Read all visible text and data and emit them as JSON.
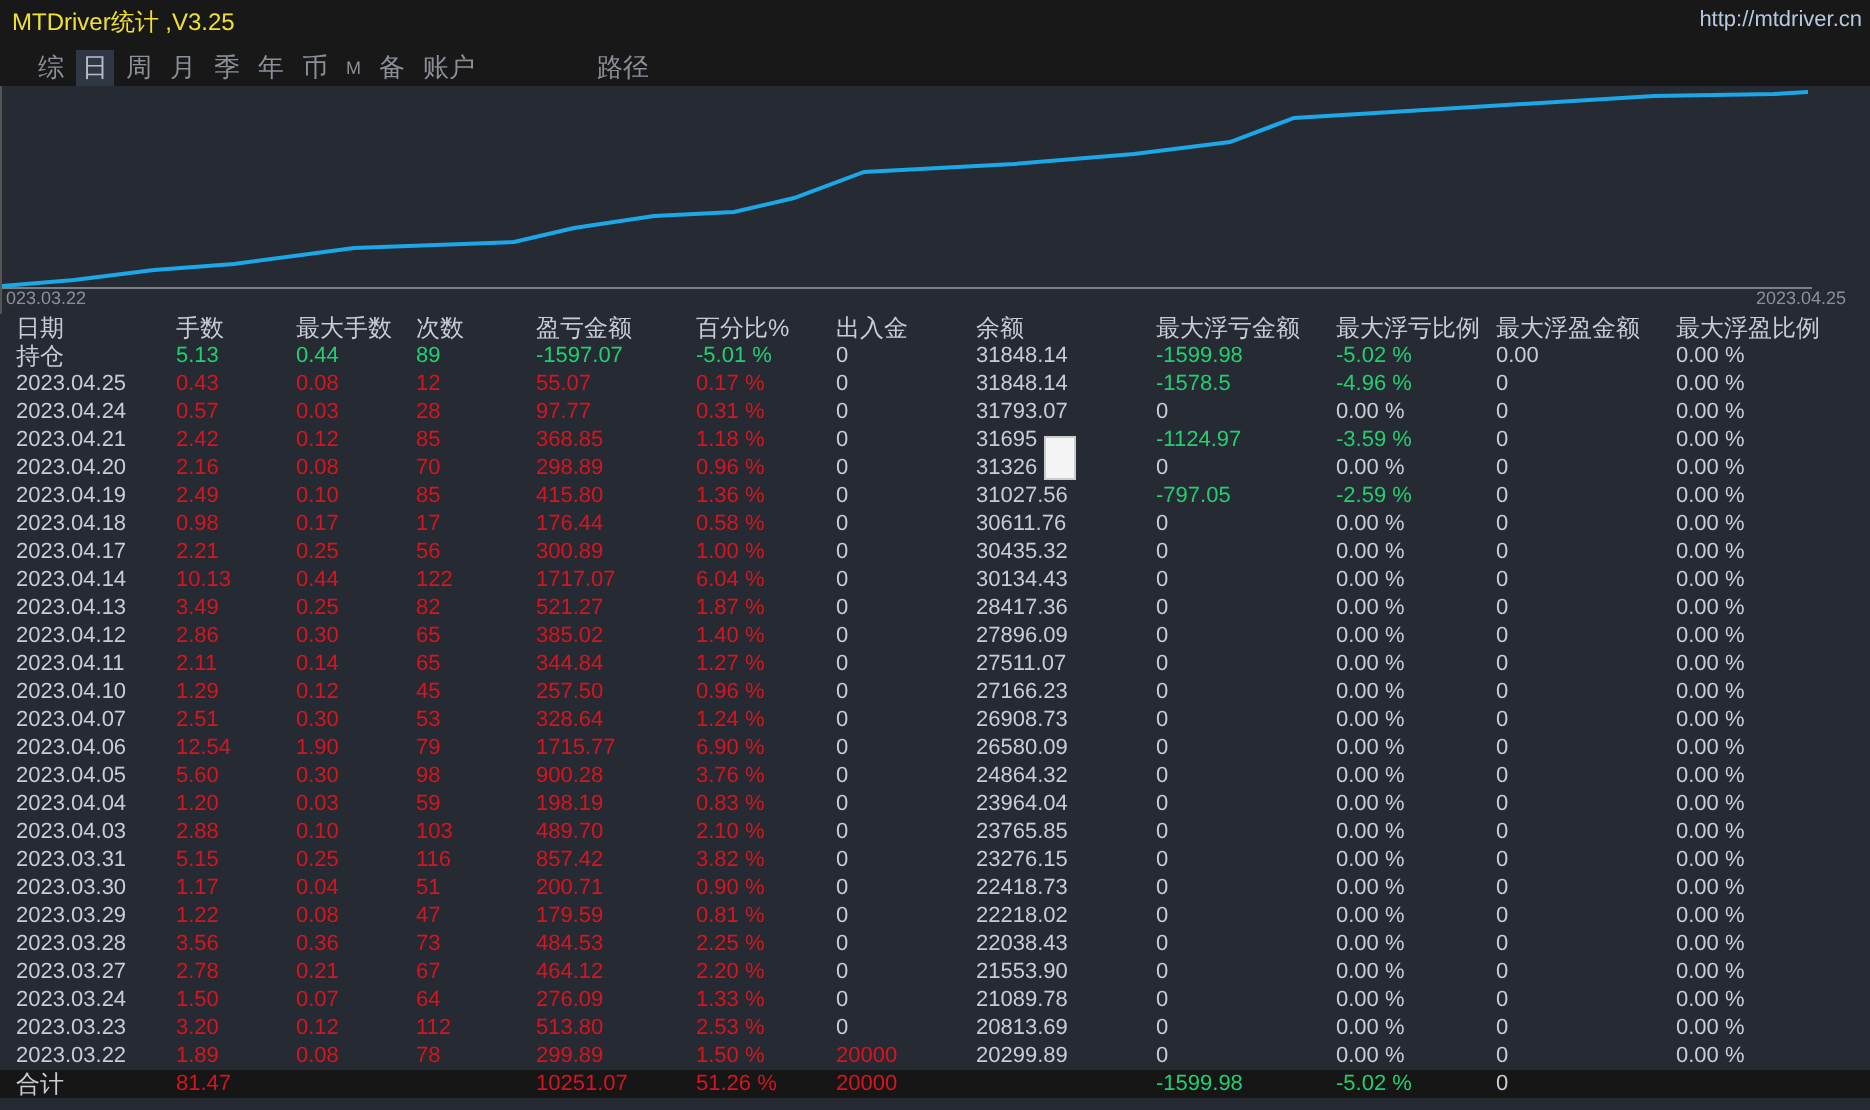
{
  "window": {
    "title": "MTDriver统计 ,V3.25",
    "link": "http://mtdriver.cn"
  },
  "tabs": [
    {
      "label": "综",
      "selected": false
    },
    {
      "label": "日",
      "selected": true
    },
    {
      "label": "周",
      "selected": false
    },
    {
      "label": "月",
      "selected": false
    },
    {
      "label": "季",
      "selected": false
    },
    {
      "label": "年",
      "selected": false
    },
    {
      "label": "币",
      "selected": false
    },
    {
      "label": "M",
      "selected": false
    },
    {
      "label": "备",
      "selected": false
    },
    {
      "label": "账户",
      "selected": false
    }
  ],
  "path_button": "路径",
  "chart": {
    "start_label": "023.03.22",
    "end_label": "2023.04.25"
  },
  "table": {
    "columns": [
      "日期",
      "手数",
      "最大手数",
      "次数",
      "盈亏金额",
      "百分比%",
      "出入金",
      "余额",
      "最大浮亏金额",
      "最大浮亏比例",
      "最大浮盈金额",
      "最大浮盈比例"
    ],
    "rows": [
      {
        "kind": "position",
        "cells": [
          "持仓",
          {
            "text": "5.13",
            "color": "#20d070"
          },
          {
            "text": "0.44",
            "color": "#20d070"
          },
          {
            "text": "89",
            "color": "#20d070"
          },
          {
            "text": "-1597.07",
            "color": "#20d070"
          },
          {
            "text": "-5.01 %",
            "color": "#20d070"
          },
          "0",
          "31848.14",
          {
            "text": "-1599.98",
            "color": "#20d070"
          },
          {
            "text": "-5.02 %",
            "color": "#20d070"
          },
          "0.00",
          "0.00 %"
        ]
      },
      {
        "kind": "day",
        "cells": [
          "2023.04.25",
          {
            "text": "0.43",
            "color": "#d8141e"
          },
          {
            "text": "0.08",
            "color": "#d8141e"
          },
          {
            "text": "12",
            "color": "#d8141e"
          },
          {
            "text": "55.07",
            "color": "#d8141e"
          },
          {
            "text": "0.17 %",
            "color": "#d8141e"
          },
          "0",
          "31848.14",
          {
            "text": "-1578.5",
            "color": "#20d070"
          },
          {
            "text": "-4.96 %",
            "color": "#20d070"
          },
          "0",
          "0.00 %"
        ]
      },
      {
        "kind": "day",
        "cells": [
          "2023.04.24",
          {
            "text": "0.57",
            "color": "#d8141e"
          },
          {
            "text": "0.03",
            "color": "#d8141e"
          },
          {
            "text": "28",
            "color": "#d8141e"
          },
          {
            "text": "97.77",
            "color": "#d8141e"
          },
          {
            "text": "0.31 %",
            "color": "#d8141e"
          },
          "0",
          "31793.07",
          "0",
          "0.00 %",
          "0",
          "0.00 %"
        ]
      },
      {
        "kind": "day",
        "cells": [
          "2023.04.21",
          {
            "text": "2.42",
            "color": "#d8141e"
          },
          {
            "text": "0.12",
            "color": "#d8141e"
          },
          {
            "text": "85",
            "color": "#d8141e"
          },
          {
            "text": "368.85",
            "color": "#d8141e"
          },
          {
            "text": "1.18 %",
            "color": "#d8141e"
          },
          "0",
          "31695",
          {
            "text": "-1124.97",
            "color": "#20d070"
          },
          {
            "text": "-3.59 %",
            "color": "#20d070"
          },
          "0",
          "0.00 %"
        ]
      },
      {
        "kind": "day",
        "cells": [
          "2023.04.20",
          {
            "text": "2.16",
            "color": "#d8141e"
          },
          {
            "text": "0.08",
            "color": "#d8141e"
          },
          {
            "text": "70",
            "color": "#d8141e"
          },
          {
            "text": "298.89",
            "color": "#d8141e"
          },
          {
            "text": "0.96 %",
            "color": "#d8141e"
          },
          "0",
          "31326",
          "0",
          "0.00 %",
          "0",
          "0.00 %"
        ]
      },
      {
        "kind": "day",
        "cells": [
          "2023.04.19",
          {
            "text": "2.49",
            "color": "#d8141e"
          },
          {
            "text": "0.10",
            "color": "#d8141e"
          },
          {
            "text": "85",
            "color": "#d8141e"
          },
          {
            "text": "415.80",
            "color": "#d8141e"
          },
          {
            "text": "1.36 %",
            "color": "#d8141e"
          },
          "0",
          "31027.56",
          {
            "text": "-797.05",
            "color": "#20d070"
          },
          {
            "text": "-2.59 %",
            "color": "#20d070"
          },
          "0",
          "0.00 %"
        ]
      },
      {
        "kind": "day",
        "cells": [
          "2023.04.18",
          {
            "text": "0.98",
            "color": "#d8141e"
          },
          {
            "text": "0.17",
            "color": "#d8141e"
          },
          {
            "text": "17",
            "color": "#d8141e"
          },
          {
            "text": "176.44",
            "color": "#d8141e"
          },
          {
            "text": "0.58 %",
            "color": "#d8141e"
          },
          "0",
          "30611.76",
          "0",
          "0.00 %",
          "0",
          "0.00 %"
        ]
      },
      {
        "kind": "day",
        "cells": [
          "2023.04.17",
          {
            "text": "2.21",
            "color": "#d8141e"
          },
          {
            "text": "0.25",
            "color": "#d8141e"
          },
          {
            "text": "56",
            "color": "#d8141e"
          },
          {
            "text": "300.89",
            "color": "#d8141e"
          },
          {
            "text": "1.00 %",
            "color": "#d8141e"
          },
          "0",
          "30435.32",
          "0",
          "0.00 %",
          "0",
          "0.00 %"
        ]
      },
      {
        "kind": "day",
        "cells": [
          "2023.04.14",
          {
            "text": "10.13",
            "color": "#d8141e"
          },
          {
            "text": "0.44",
            "color": "#d8141e"
          },
          {
            "text": "122",
            "color": "#d8141e"
          },
          {
            "text": "1717.07",
            "color": "#d8141e"
          },
          {
            "text": "6.04 %",
            "color": "#d8141e"
          },
          "0",
          "30134.43",
          "0",
          "0.00 %",
          "0",
          "0.00 %"
        ]
      },
      {
        "kind": "day",
        "cells": [
          "2023.04.13",
          {
            "text": "3.49",
            "color": "#d8141e"
          },
          {
            "text": "0.25",
            "color": "#d8141e"
          },
          {
            "text": "82",
            "color": "#d8141e"
          },
          {
            "text": "521.27",
            "color": "#d8141e"
          },
          {
            "text": "1.87 %",
            "color": "#d8141e"
          },
          "0",
          "28417.36",
          "0",
          "0.00 %",
          "0",
          "0.00 %"
        ]
      },
      {
        "kind": "day",
        "cells": [
          "2023.04.12",
          {
            "text": "2.86",
            "color": "#d8141e"
          },
          {
            "text": "0.30",
            "color": "#d8141e"
          },
          {
            "text": "65",
            "color": "#d8141e"
          },
          {
            "text": "385.02",
            "color": "#d8141e"
          },
          {
            "text": "1.40 %",
            "color": "#d8141e"
          },
          "0",
          "27896.09",
          "0",
          "0.00 %",
          "0",
          "0.00 %"
        ]
      },
      {
        "kind": "day",
        "cells": [
          "2023.04.11",
          {
            "text": "2.11",
            "color": "#d8141e"
          },
          {
            "text": "0.14",
            "color": "#d8141e"
          },
          {
            "text": "65",
            "color": "#d8141e"
          },
          {
            "text": "344.84",
            "color": "#d8141e"
          },
          {
            "text": "1.27 %",
            "color": "#d8141e"
          },
          "0",
          "27511.07",
          "0",
          "0.00 %",
          "0",
          "0.00 %"
        ]
      },
      {
        "kind": "day",
        "cells": [
          "2023.04.10",
          {
            "text": "1.29",
            "color": "#d8141e"
          },
          {
            "text": "0.12",
            "color": "#d8141e"
          },
          {
            "text": "45",
            "color": "#d8141e"
          },
          {
            "text": "257.50",
            "color": "#d8141e"
          },
          {
            "text": "0.96 %",
            "color": "#d8141e"
          },
          "0",
          "27166.23",
          "0",
          "0.00 %",
          "0",
          "0.00 %"
        ]
      },
      {
        "kind": "day",
        "cells": [
          "2023.04.07",
          {
            "text": "2.51",
            "color": "#d8141e"
          },
          {
            "text": "0.30",
            "color": "#d8141e"
          },
          {
            "text": "53",
            "color": "#d8141e"
          },
          {
            "text": "328.64",
            "color": "#d8141e"
          },
          {
            "text": "1.24 %",
            "color": "#d8141e"
          },
          "0",
          "26908.73",
          "0",
          "0.00 %",
          "0",
          "0.00 %"
        ]
      },
      {
        "kind": "day",
        "cells": [
          "2023.04.06",
          {
            "text": "12.54",
            "color": "#d8141e"
          },
          {
            "text": "1.90",
            "color": "#d8141e"
          },
          {
            "text": "79",
            "color": "#d8141e"
          },
          {
            "text": "1715.77",
            "color": "#d8141e"
          },
          {
            "text": "6.90 %",
            "color": "#d8141e"
          },
          "0",
          "26580.09",
          "0",
          "0.00 %",
          "0",
          "0.00 %"
        ]
      },
      {
        "kind": "day",
        "cells": [
          "2023.04.05",
          {
            "text": "5.60",
            "color": "#d8141e"
          },
          {
            "text": "0.30",
            "color": "#d8141e"
          },
          {
            "text": "98",
            "color": "#d8141e"
          },
          {
            "text": "900.28",
            "color": "#d8141e"
          },
          {
            "text": "3.76 %",
            "color": "#d8141e"
          },
          "0",
          "24864.32",
          "0",
          "0.00 %",
          "0",
          "0.00 %"
        ]
      },
      {
        "kind": "day",
        "cells": [
          "2023.04.04",
          {
            "text": "1.20",
            "color": "#d8141e"
          },
          {
            "text": "0.03",
            "color": "#d8141e"
          },
          {
            "text": "59",
            "color": "#d8141e"
          },
          {
            "text": "198.19",
            "color": "#d8141e"
          },
          {
            "text": "0.83 %",
            "color": "#d8141e"
          },
          "0",
          "23964.04",
          "0",
          "0.00 %",
          "0",
          "0.00 %"
        ]
      },
      {
        "kind": "day",
        "cells": [
          "2023.04.03",
          {
            "text": "2.88",
            "color": "#d8141e"
          },
          {
            "text": "0.10",
            "color": "#d8141e"
          },
          {
            "text": "103",
            "color": "#d8141e"
          },
          {
            "text": "489.70",
            "color": "#d8141e"
          },
          {
            "text": "2.10 %",
            "color": "#d8141e"
          },
          "0",
          "23765.85",
          "0",
          "0.00 %",
          "0",
          "0.00 %"
        ]
      },
      {
        "kind": "day",
        "cells": [
          "2023.03.31",
          {
            "text": "5.15",
            "color": "#d8141e"
          },
          {
            "text": "0.25",
            "color": "#d8141e"
          },
          {
            "text": "116",
            "color": "#d8141e"
          },
          {
            "text": "857.42",
            "color": "#d8141e"
          },
          {
            "text": "3.82 %",
            "color": "#d8141e"
          },
          "0",
          "23276.15",
          "0",
          "0.00 %",
          "0",
          "0.00 %"
        ]
      },
      {
        "kind": "day",
        "cells": [
          "2023.03.30",
          {
            "text": "1.17",
            "color": "#d8141e"
          },
          {
            "text": "0.04",
            "color": "#d8141e"
          },
          {
            "text": "51",
            "color": "#d8141e"
          },
          {
            "text": "200.71",
            "color": "#d8141e"
          },
          {
            "text": "0.90 %",
            "color": "#d8141e"
          },
          "0",
          "22418.73",
          "0",
          "0.00 %",
          "0",
          "0.00 %"
        ]
      },
      {
        "kind": "day",
        "cells": [
          "2023.03.29",
          {
            "text": "1.22",
            "color": "#d8141e"
          },
          {
            "text": "0.08",
            "color": "#d8141e"
          },
          {
            "text": "47",
            "color": "#d8141e"
          },
          {
            "text": "179.59",
            "color": "#d8141e"
          },
          {
            "text": "0.81 %",
            "color": "#d8141e"
          },
          "0",
          "22218.02",
          "0",
          "0.00 %",
          "0",
          "0.00 %"
        ]
      },
      {
        "kind": "day",
        "cells": [
          "2023.03.28",
          {
            "text": "3.56",
            "color": "#d8141e"
          },
          {
            "text": "0.36",
            "color": "#d8141e"
          },
          {
            "text": "73",
            "color": "#d8141e"
          },
          {
            "text": "484.53",
            "color": "#d8141e"
          },
          {
            "text": "2.25 %",
            "color": "#d8141e"
          },
          "0",
          "22038.43",
          "0",
          "0.00 %",
          "0",
          "0.00 %"
        ]
      },
      {
        "kind": "day",
        "cells": [
          "2023.03.27",
          {
            "text": "2.78",
            "color": "#d8141e"
          },
          {
            "text": "0.21",
            "color": "#d8141e"
          },
          {
            "text": "67",
            "color": "#d8141e"
          },
          {
            "text": "464.12",
            "color": "#d8141e"
          },
          {
            "text": "2.20 %",
            "color": "#d8141e"
          },
          "0",
          "21553.90",
          "0",
          "0.00 %",
          "0",
          "0.00 %"
        ]
      },
      {
        "kind": "day",
        "cells": [
          "2023.03.24",
          {
            "text": "1.50",
            "color": "#d8141e"
          },
          {
            "text": "0.07",
            "color": "#d8141e"
          },
          {
            "text": "64",
            "color": "#d8141e"
          },
          {
            "text": "276.09",
            "color": "#d8141e"
          },
          {
            "text": "1.33 %",
            "color": "#d8141e"
          },
          "0",
          "21089.78",
          "0",
          "0.00 %",
          "0",
          "0.00 %"
        ]
      },
      {
        "kind": "day",
        "cells": [
          "2023.03.23",
          {
            "text": "3.20",
            "color": "#d8141e"
          },
          {
            "text": "0.12",
            "color": "#d8141e"
          },
          {
            "text": "112",
            "color": "#d8141e"
          },
          {
            "text": "513.80",
            "color": "#d8141e"
          },
          {
            "text": "2.53 %",
            "color": "#d8141e"
          },
          "0",
          "20813.69",
          "0",
          "0.00 %",
          "0",
          "0.00 %"
        ]
      },
      {
        "kind": "day",
        "cells": [
          "2023.03.22",
          {
            "text": "1.89",
            "color": "#d8141e"
          },
          {
            "text": "0.08",
            "color": "#d8141e"
          },
          {
            "text": "78",
            "color": "#d8141e"
          },
          {
            "text": "299.89",
            "color": "#d8141e"
          },
          {
            "text": "1.50 %",
            "color": "#d8141e"
          },
          {
            "text": "20000",
            "color": "#d8141e"
          },
          "20299.89",
          "0",
          "0.00 %",
          "0",
          "0.00 %"
        ]
      },
      {
        "kind": "total",
        "cells": [
          "合计",
          {
            "text": "81.47",
            "color": "#d8141e"
          },
          null,
          null,
          {
            "text": "10251.07",
            "color": "#d8141e"
          },
          {
            "text": "51.26 %",
            "color": "#d8141e"
          },
          {
            "text": "20000",
            "color": "#d8141e"
          },
          null,
          {
            "text": "-1599.98",
            "color": "#20d070"
          },
          {
            "text": "-5.02 %",
            "color": "#20d070"
          },
          "0",
          null
        ]
      }
    ]
  }
}
